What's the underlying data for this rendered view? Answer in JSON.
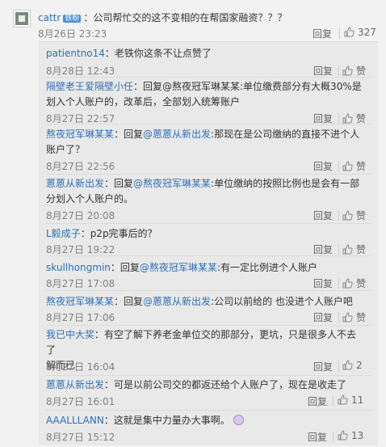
{
  "main": {
    "user": "cattr",
    "badge": "铁粉",
    "text": "：公司帮忙交的这不变相的在帮国家融资？？？",
    "time": "8月26日 23:23",
    "reply_label": "回复",
    "likes": "327"
  },
  "replies": [
    {
      "user": "patientno14",
      "text": "：老铁你这条不让点赞了",
      "time": "8月28日 12:43",
      "reply_label": "回复",
      "likes": "赞"
    },
    {
      "user": "隔壁老王爱隔壁小任",
      "line1": "：回复@熬夜冠军琳某某:单位缴费部分有大概30%是",
      "line2": "划入个人账户的，改革后，全部划入统筹账户",
      "time": "8月27日 22:57",
      "reply_label": "回复",
      "likes": "赞"
    },
    {
      "user": "熬夜冠军琳某某",
      "mid": "：回复",
      "mention": "@蒽蒽从新出发",
      "line1rest": ":那现在是公司缴纳的直接不进个人",
      "line2": "账户了？",
      "time": "8月27日 22:56",
      "reply_label": "回复",
      "likes": "赞"
    },
    {
      "user": "蒽蒽从新出发",
      "mid": "：回复",
      "mention": "@熬夜冠军琳某某",
      "line1rest": ":单位缴纳的按照比例也是会有一部",
      "line2": "分划入个人账户的。",
      "time": "8月27日 20:08",
      "reply_label": "回复",
      "likes": "赞"
    },
    {
      "user": "L毅成子",
      "text": "：p2p完事后的？",
      "time": "8月27日 19:22",
      "reply_label": "回复",
      "likes": "赞"
    },
    {
      "user": "skullhongmin",
      "mid": "：回复",
      "mention": "@熬夜冠军琳某某",
      "rest": ":有一定比例进个人账户",
      "time": "8月27日 17:08",
      "reply_label": "回复",
      "likes": "赞"
    },
    {
      "user": "熬夜冠军琳某某",
      "mid": "：回复",
      "mention": "@蒽蒽从新出发",
      "rest": ":公司以前给的 也没进个人账户吧",
      "time": "8月27日 17:06",
      "reply_label": "回复",
      "likes": "赞"
    },
    {
      "user": "我已中大奖",
      "line1": "：有空了解下养老金单位交的那部分，更坑，只是很多人不去了",
      "line2": "解而已",
      "time": "8月27日 16:04",
      "reply_label": "回复",
      "likes": "2"
    },
    {
      "user": "蒽蒽从新出发",
      "text": "：可是以前公司交的都返还给个人账户了，现在是收走了",
      "time": "8月27日 16:01",
      "reply_label": "回复",
      "likes": "11"
    },
    {
      "user": "AAALLLANN",
      "text": "：这就是集中力量办大事啊。",
      "time": "8月27日 15:12",
      "reply_label": "回复",
      "likes": "13"
    }
  ]
}
